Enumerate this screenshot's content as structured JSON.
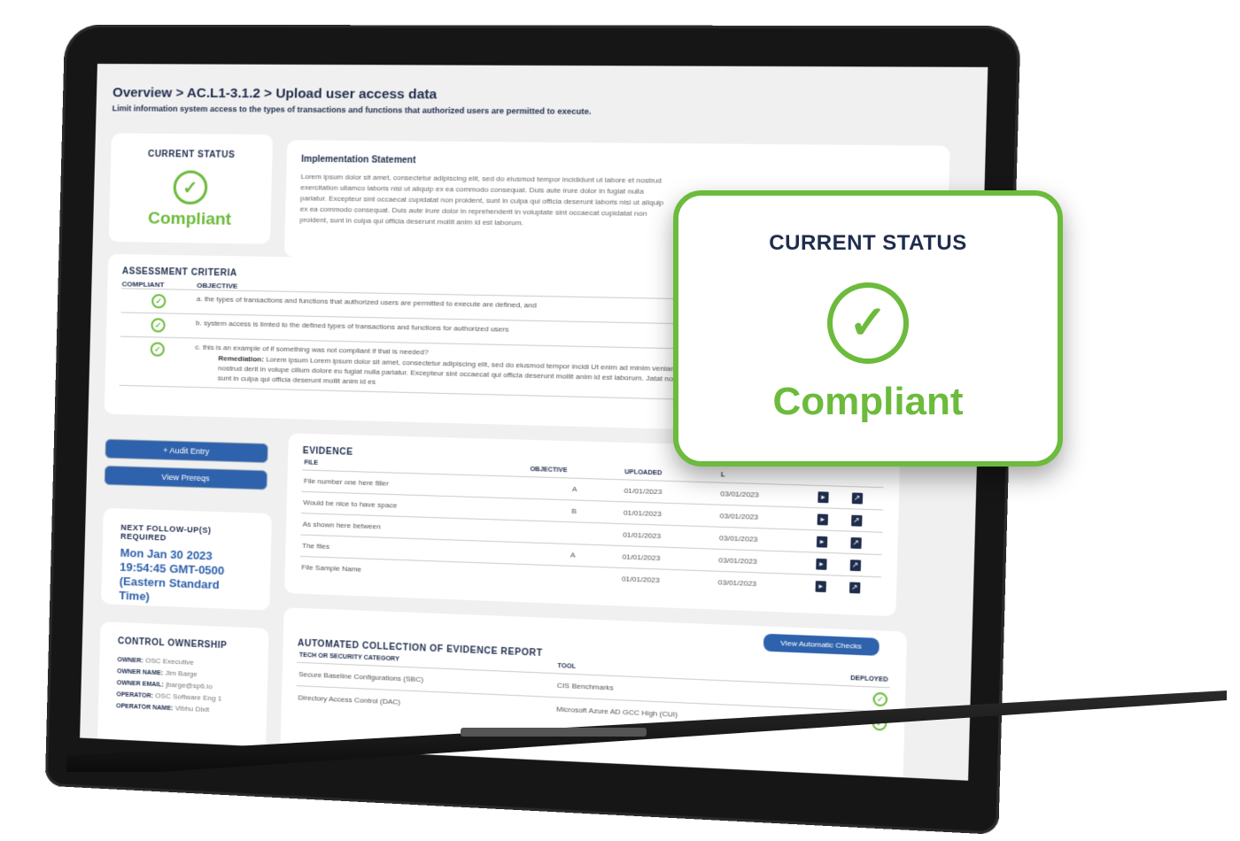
{
  "breadcrumb": "Overview > AC.L1-3.1.2 > Upload user access data",
  "subtitle": "Limit information system access to the types of transactions and functions that authorized users are permitted to execute.",
  "status": {
    "label": "CURRENT STATUS",
    "value": "Compliant",
    "icon": "check-circle-icon",
    "color": "#6cbb3c"
  },
  "implementation": {
    "title": "Implementation Statement",
    "text": "Lorem ipsum dolor sit amet, consectetur adipiscing elit, sed do eiusmod tempor incididunt ut labore et nostrud exercitation ullamco laboris nisi ut aliquip ex ea commodo consequat. Duis aute irure dolor in fugiat nulla pariatur. Excepteur sint occaecat cupidatat non proident, sunt in culpa qui officia deserunt laboris nisi ut aliquip ex ea commodo consequat. Duis aute irure dolor in reprehenderit in voluptate sint occaecat cupidatat non proident, sunt in culpa qui officia deserunt mollit anim id est laborum."
  },
  "assessment": {
    "title": "ASSESSMENT CRITERIA",
    "col_compliant": "COMPLIANT",
    "col_objective": "OBJECTIVE",
    "rows": [
      {
        "text": "a. the types of transactions and functions that authorized users are permitted to execute are defined, and"
      },
      {
        "text": "b. system access is limted to the defined types of transactions and functions for authorized users"
      },
      {
        "text": "c. this is an example of if something was not compliant if that is needed?",
        "remediation_label": "Remediation:",
        "remediation": "Lorem ipsum Lorem ipsum dolor sit amet, consectetur adipiscing elit, sed do eiusmod tempor incidi Ut enim ad minim veniam, quis nostrud derit in volupe cillum dolore eu fugiat nulla pariatur. Excepteur sint occaecat qui officia deserunt mollit anim id est laborum. Jatat non proident, sunt in culpa qui officia deserunt mollit anim id es"
      }
    ]
  },
  "buttons": {
    "audit": "+  Audit Entry",
    "prereqs": "View Prereqs"
  },
  "followup": {
    "title": "NEXT FOLLOW-UP(S) REQUIRED",
    "date": "Mon Jan 30 2023 19:54:45 GMT-0500 (Eastern Standard Time)"
  },
  "ownership": {
    "title": "CONTROL OWNERSHIP",
    "fields": [
      {
        "k": "OWNER:",
        "v": "OSC Executive"
      },
      {
        "k": "OWNER NAME:",
        "v": "Jim Barge"
      },
      {
        "k": "OWNER EMAIL:",
        "v": "jbarge@sp6.io"
      },
      {
        "k": "OPERATOR:",
        "v": "OSC Software Eng 1"
      },
      {
        "k": "OPERATOR NAME:",
        "v": "Vibhu Dixit"
      }
    ]
  },
  "evidence": {
    "title": "EVIDENCE",
    "cols": [
      "FILE",
      "OBJECTIVE",
      "UPLOADED",
      "L"
    ],
    "rows": [
      {
        "file": "File number one here filler",
        "objective": "A",
        "uploaded": "01/01/2023",
        "last": "03/01/2023"
      },
      {
        "file": "Would be nice to have space",
        "objective": "B",
        "uploaded": "01/01/2023",
        "last": "03/01/2023"
      },
      {
        "file": "As shown here between",
        "objective": "",
        "uploaded": "01/01/2023",
        "last": "03/01/2023"
      },
      {
        "file": "The files",
        "objective": "A",
        "uploaded": "01/01/2023",
        "last": "03/01/2023"
      },
      {
        "file": "File Sample Name",
        "objective": "",
        "uploaded": "01/01/2023",
        "last": "03/01/2023"
      }
    ]
  },
  "automated": {
    "title": "AUTOMATED COLLECTION OF EVIDENCE REPORT",
    "button": "View Automatic Checks",
    "cols": [
      "TECH OR SECURITY CATEGORY",
      "TOOL",
      "DEPLOYED"
    ],
    "rows": [
      {
        "category": "Secure Baseline Configurations (SBC)",
        "tool": "CIS Benchmarks",
        "deployed": true
      },
      {
        "category": "Directory Access Control (DAC)",
        "tool": "Microsoft Azure AD GCC High (CUI)",
        "deployed": true
      }
    ]
  },
  "callout": {
    "label": "CURRENT STATUS",
    "value": "Compliant"
  }
}
